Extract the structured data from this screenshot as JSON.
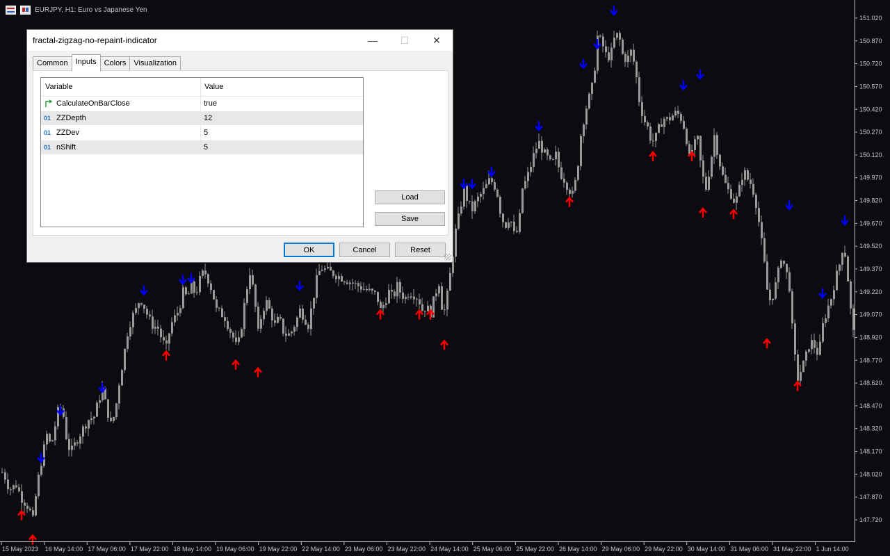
{
  "chart": {
    "title": "EURJPY, H1:  Euro vs Japanese Yen",
    "colors": {
      "background": "#0b0b10",
      "candle": "#9a9a9a",
      "up_arrow": "#ff0000",
      "down_arrow": "#0000ff",
      "axis_text": "#c8c8c8"
    },
    "icons": [
      "chart-menu-icon",
      "flag-icon"
    ]
  },
  "chart_data": {
    "type": "candlestick",
    "ylim": [
      147.62,
      151.1
    ],
    "y_ticks": [
      "151.020",
      "150.870",
      "150.720",
      "150.570",
      "150.420",
      "150.270",
      "150.120",
      "149.970",
      "149.820",
      "149.670",
      "149.520",
      "149.370",
      "149.220",
      "149.070",
      "148.920",
      "148.770",
      "148.620",
      "148.470",
      "148.320",
      "148.170",
      "148.020",
      "147.870",
      "147.720"
    ],
    "x_ticks": [
      "15 May 2023",
      "16 May 14:00",
      "17 May 06:00",
      "17 May 22:00",
      "18 May 14:00",
      "19 May 06:00",
      "19 May 22:00",
      "22 May 14:00",
      "23 May 06:00",
      "23 May 22:00",
      "24 May 14:00",
      "25 May 06:00",
      "25 May 22:00",
      "26 May 14:00",
      "29 May 06:00",
      "29 May 22:00",
      "30 May 14:00",
      "31 May 06:00",
      "31 May 22:00",
      "1 Jun 14:00"
    ],
    "path_points": [
      [
        0,
        148.05
      ],
      [
        6,
        148.0
      ],
      [
        12,
        147.92
      ],
      [
        22,
        147.95
      ],
      [
        30,
        147.86
      ],
      [
        40,
        147.8
      ],
      [
        46,
        147.72
      ],
      [
        52,
        147.95
      ],
      [
        60,
        148.15
      ],
      [
        66,
        148.28
      ],
      [
        72,
        148.2
      ],
      [
        78,
        148.34
      ],
      [
        84,
        148.48
      ],
      [
        90,
        148.4
      ],
      [
        96,
        148.2
      ],
      [
        102,
        148.18
      ],
      [
        110,
        148.25
      ],
      [
        118,
        148.32
      ],
      [
        126,
        148.38
      ],
      [
        134,
        148.4
      ],
      [
        140,
        148.5
      ],
      [
        146,
        148.58
      ],
      [
        152,
        148.45
      ],
      [
        158,
        148.35
      ],
      [
        164,
        148.42
      ],
      [
        170,
        148.62
      ],
      [
        176,
        148.78
      ],
      [
        182,
        148.95
      ],
      [
        188,
        149.05
      ],
      [
        194,
        149.1
      ],
      [
        200,
        149.18
      ],
      [
        206,
        149.12
      ],
      [
        212,
        149.05
      ],
      [
        218,
        149.0
      ],
      [
        226,
        148.98
      ],
      [
        232,
        148.9
      ],
      [
        238,
        148.85
      ],
      [
        244,
        149.0
      ],
      [
        250,
        149.05
      ],
      [
        256,
        149.1
      ],
      [
        262,
        149.22
      ],
      [
        268,
        149.18
      ],
      [
        274,
        149.26
      ],
      [
        280,
        149.2
      ],
      [
        286,
        149.3
      ],
      [
        292,
        149.36
      ],
      [
        298,
        149.3
      ],
      [
        304,
        149.22
      ],
      [
        310,
        149.1
      ],
      [
        316,
        149.08
      ],
      [
        322,
        149.05
      ],
      [
        328,
        148.98
      ],
      [
        334,
        148.92
      ],
      [
        340,
        148.84
      ],
      [
        346,
        149.0
      ],
      [
        352,
        149.2
      ],
      [
        358,
        149.35
      ],
      [
        364,
        149.2
      ],
      [
        370,
        148.95
      ],
      [
        376,
        149.1
      ],
      [
        382,
        149.15
      ],
      [
        388,
        149.08
      ],
      [
        394,
        149.0
      ],
      [
        400,
        149.05
      ],
      [
        406,
        148.96
      ],
      [
        412,
        148.93
      ],
      [
        418,
        148.96
      ],
      [
        424,
        149.02
      ],
      [
        430,
        149.1
      ],
      [
        436,
        149.05
      ],
      [
        442,
        149.0
      ],
      [
        448,
        149.15
      ],
      [
        454,
        149.3
      ],
      [
        460,
        149.38
      ],
      [
        540,
        149.2
      ],
      [
        546,
        149.1
      ],
      [
        552,
        149.15
      ],
      [
        558,
        149.22
      ],
      [
        564,
        149.18
      ],
      [
        570,
        149.26
      ],
      [
        576,
        149.2
      ],
      [
        582,
        149.18
      ],
      [
        588,
        149.22
      ],
      [
        594,
        149.2
      ],
      [
        600,
        149.18
      ],
      [
        606,
        149.1
      ],
      [
        612,
        149.12
      ],
      [
        618,
        149.08
      ],
      [
        624,
        149.2
      ],
      [
        630,
        149.28
      ],
      [
        636,
        149.05
      ],
      [
        642,
        149.2
      ],
      [
        648,
        149.4
      ],
      [
        654,
        149.62
      ],
      [
        660,
        149.75
      ],
      [
        666,
        149.9
      ],
      [
        672,
        149.8
      ],
      [
        678,
        149.76
      ],
      [
        684,
        149.82
      ],
      [
        690,
        149.86
      ],
      [
        696,
        149.9
      ],
      [
        702,
        149.95
      ],
      [
        708,
        149.94
      ],
      [
        714,
        149.86
      ],
      [
        720,
        149.7
      ],
      [
        726,
        149.66
      ],
      [
        732,
        149.72
      ],
      [
        738,
        149.6
      ],
      [
        744,
        149.62
      ],
      [
        750,
        149.9
      ],
      [
        756,
        149.96
      ],
      [
        762,
        150.05
      ],
      [
        768,
        150.15
      ],
      [
        774,
        150.2
      ],
      [
        780,
        150.14
      ],
      [
        786,
        150.1
      ],
      [
        792,
        150.05
      ],
      [
        798,
        150.12
      ],
      [
        804,
        150.0
      ],
      [
        810,
        149.96
      ],
      [
        816,
        149.9
      ],
      [
        822,
        149.86
      ],
      [
        828,
        149.98
      ],
      [
        834,
        150.25
      ],
      [
        840,
        150.4
      ],
      [
        846,
        150.5
      ],
      [
        852,
        150.6
      ],
      [
        858,
        150.9
      ],
      [
        864,
        150.86
      ],
      [
        870,
        150.78
      ],
      [
        876,
        150.76
      ],
      [
        882,
        150.88
      ],
      [
        888,
        150.92
      ],
      [
        894,
        150.78
      ],
      [
        900,
        150.74
      ],
      [
        906,
        150.8
      ],
      [
        912,
        150.7
      ],
      [
        918,
        150.48
      ],
      [
        924,
        150.36
      ],
      [
        930,
        150.3
      ],
      [
        936,
        150.2
      ],
      [
        942,
        150.24
      ],
      [
        948,
        150.32
      ],
      [
        954,
        150.36
      ],
      [
        960,
        150.35
      ],
      [
        966,
        150.38
      ],
      [
        972,
        150.4
      ],
      [
        978,
        150.36
      ],
      [
        984,
        150.28
      ],
      [
        990,
        150.1
      ],
      [
        996,
        150.18
      ],
      [
        1002,
        150.22
      ],
      [
        1008,
        150.0
      ],
      [
        1014,
        149.9
      ],
      [
        1020,
        150.05
      ],
      [
        1026,
        150.25
      ],
      [
        1032,
        150.1
      ],
      [
        1038,
        149.98
      ],
      [
        1044,
        149.9
      ],
      [
        1050,
        149.86
      ],
      [
        1056,
        149.8
      ],
      [
        1062,
        149.9
      ],
      [
        1068,
        150.02
      ],
      [
        1074,
        149.96
      ],
      [
        1080,
        149.92
      ],
      [
        1086,
        149.8
      ],
      [
        1092,
        149.62
      ],
      [
        1098,
        149.4
      ],
      [
        1104,
        149.15
      ],
      [
        1110,
        149.2
      ],
      [
        1116,
        149.3
      ],
      [
        1122,
        149.45
      ],
      [
        1128,
        149.38
      ],
      [
        1134,
        149.25
      ],
      [
        1140,
        148.85
      ],
      [
        1146,
        148.65
      ],
      [
        1152,
        148.72
      ],
      [
        1158,
        148.8
      ],
      [
        1164,
        148.9
      ],
      [
        1170,
        148.86
      ],
      [
        1176,
        148.8
      ],
      [
        1182,
        149.0
      ],
      [
        1188,
        149.1
      ],
      [
        1194,
        149.18
      ],
      [
        1200,
        149.3
      ],
      [
        1206,
        149.4
      ],
      [
        1212,
        149.55
      ],
      [
        1218,
        149.3
      ],
      [
        1222,
        149.1
      ],
      [
        1226,
        148.95
      ]
    ],
    "down_arrows": [
      [
        59,
        148.13
      ],
      [
        87,
        148.44
      ],
      [
        147,
        148.59
      ],
      [
        207,
        149.23
      ],
      [
        263,
        149.3
      ],
      [
        275,
        149.31
      ],
      [
        431,
        149.26
      ],
      [
        667,
        149.93
      ],
      [
        679,
        149.93
      ],
      [
        707,
        150.01
      ],
      [
        775,
        150.31
      ],
      [
        839,
        150.72
      ],
      [
        859,
        150.85
      ],
      [
        883,
        151.07
      ],
      [
        983,
        150.58
      ],
      [
        1007,
        150.65
      ],
      [
        1135,
        149.79
      ],
      [
        1183,
        149.21
      ],
      [
        1215,
        149.69
      ]
    ],
    "up_arrows": [
      [
        31,
        147.75
      ],
      [
        47,
        147.59
      ],
      [
        239,
        148.8
      ],
      [
        339,
        148.74
      ],
      [
        371,
        148.69
      ],
      [
        547,
        149.07
      ],
      [
        603,
        149.07
      ],
      [
        619,
        149.07
      ],
      [
        639,
        148.87
      ],
      [
        819,
        149.81
      ],
      [
        939,
        150.11
      ],
      [
        995,
        150.11
      ],
      [
        1011,
        149.74
      ],
      [
        1055,
        149.73
      ],
      [
        1103,
        148.88
      ],
      [
        1147,
        148.6
      ]
    ]
  },
  "dialog": {
    "title": "fractal-zigzag-no-repaint-indicator",
    "win_min": "—",
    "win_max": "☐",
    "win_close": "✕",
    "tabs": [
      "Common",
      "Inputs",
      "Colors",
      "Visualization"
    ],
    "active_tab": 1,
    "grid": {
      "header_variable": "Variable",
      "header_value": "Value",
      "rows": [
        {
          "type": "bool",
          "name": "CalculateOnBarClose",
          "value": "true"
        },
        {
          "type": "01",
          "name": "ZZDepth",
          "value": "12"
        },
        {
          "type": "01",
          "name": "ZZDev",
          "value": "5"
        },
        {
          "type": "01",
          "name": "nShift",
          "value": "5"
        }
      ]
    },
    "load_label": "Load",
    "save_label": "Save",
    "ok_label": "OK",
    "cancel_label": "Cancel",
    "reset_label": "Reset"
  }
}
